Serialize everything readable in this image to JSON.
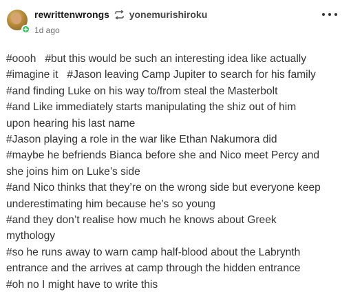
{
  "post": {
    "author": "rewrittenwrongs",
    "reblogged_from": "yonemurishiroku",
    "timestamp": "1d ago",
    "tags": [
      "#oooh   #but this would be such an interesting idea like actually",
      "#imagine it   #Jason leaving Camp Jupiter to search for his family",
      "#and finding Luke on his way to/from steal the Masterbolt",
      "#and Like immediately starts manipulating the shiz out of him",
      "upon hearing his last name",
      "#Jason playing a role in the war like Ethan Nakumora did",
      "#maybe he befriends Bianca before she and Nico meet Percy and",
      "she joins him on Luke’s side",
      "#and Nico thinks that they’re on the wrong side but everyone keep",
      "underestimating him because he’s so young",
      "#and they don’t realise how much he knows about Greek",
      "mythology",
      "#so he runs away to warn camp half-blood about the Labrynth",
      "entrance and the arrives at camp through the hidden entrance",
      "#oh no I might have to write this"
    ]
  },
  "icons": {
    "avatar": "avatar-image",
    "badge": "follow-plus-icon",
    "reblog": "reblog-icon",
    "more": "more-options-icon"
  },
  "colors": {
    "badge": "#2fbd5a",
    "text": "#333333",
    "muted": "#6f6f6f"
  }
}
